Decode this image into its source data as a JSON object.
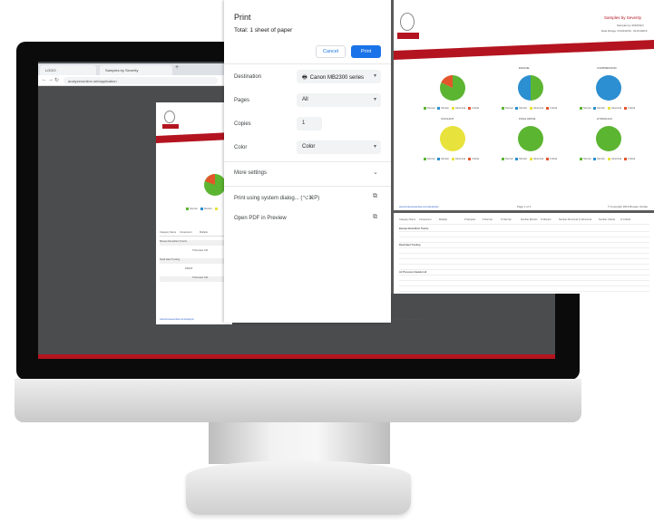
{
  "browser": {
    "tabs": [
      "LOGO",
      "Samples by Severity"
    ],
    "url": "analyzenonline.net/application"
  },
  "preview": {
    "footer_link": "www.bureauveritas.com/analysis",
    "footer_page": "Page 1 of 1",
    "footer_copy": "© Copyright 2016 Bureau Veritas",
    "legend": [
      "Normal",
      "Monitor",
      "Abnormal",
      "Critical"
    ],
    "table_headers": [
      "Category Name",
      "Component",
      "Multiple"
    ],
    "table_rows": [
      "Bureau Demolition Tractor",
      "Tribometer 1#1",
      "Dead Haul Truckng",
      "ZZDZZ",
      "Tribometer 1#1"
    ]
  },
  "dialog": {
    "title": "Print",
    "total": "Total: 1 sheet of paper",
    "cancel_label": "Cancel",
    "print_label": "Print",
    "destination_label": "Destination",
    "destination_value": "Canon MB2300 series",
    "pages_label": "Pages",
    "pages_value": "All",
    "copies_label": "Copies",
    "copies_value": "1",
    "color_label": "Color",
    "color_value": "Color",
    "more_settings": "More settings",
    "system_dialog": "Print using system dialog... (⌥⌘P)",
    "open_pdf": "Open PDF in Preview"
  },
  "report": {
    "title": "Samples by Severity",
    "meta1": "Samples by 2016/01/1",
    "meta2": "Date Range: 01/01/2016 - 01/31/2016",
    "footer_link": "www.bureauveritas.com/analysis",
    "footer_page": "Page 1 of 1",
    "footer_copy": "© Copyright 2016 Bureau Veritas",
    "legend": [
      "Normal",
      "Monitor",
      "Abnormal",
      "Critical"
    ],
    "pies": [
      {
        "label": "",
        "normal": 0.82,
        "critical": 0.18
      },
      {
        "label": "ENGINE",
        "normal": 0.5,
        "monitor": 0.5
      },
      {
        "label": "COMPRESSOR",
        "monitor": 1.0
      },
      {
        "label": "COOLANT",
        "abnormal": 1.0
      },
      {
        "label": "FINAL DRIVE",
        "normal": 1.0
      },
      {
        "label": "HYDRAULIC",
        "normal": 1.0
      }
    ],
    "table_headers": [
      "Category Name",
      "Component",
      "Multiple",
      "# Samples",
      "# Normal",
      "% Normal",
      "Number Monitor",
      "% Monitor",
      "Number Abnormal",
      "% Abnormal",
      "Number Critical",
      "% Critical"
    ],
    "table_groups": [
      "Bureau Demolition Tractor",
      "Dead Haul Truckng",
      "Air Pressure Canada Ltd"
    ]
  },
  "colors": {
    "normal": "#5cb531",
    "monitor": "#2b8fd1",
    "abnormal": "#e8e23c",
    "critical": "#e3562b",
    "brand_red": "#b3141f",
    "print_blue": "#1a73e8"
  }
}
